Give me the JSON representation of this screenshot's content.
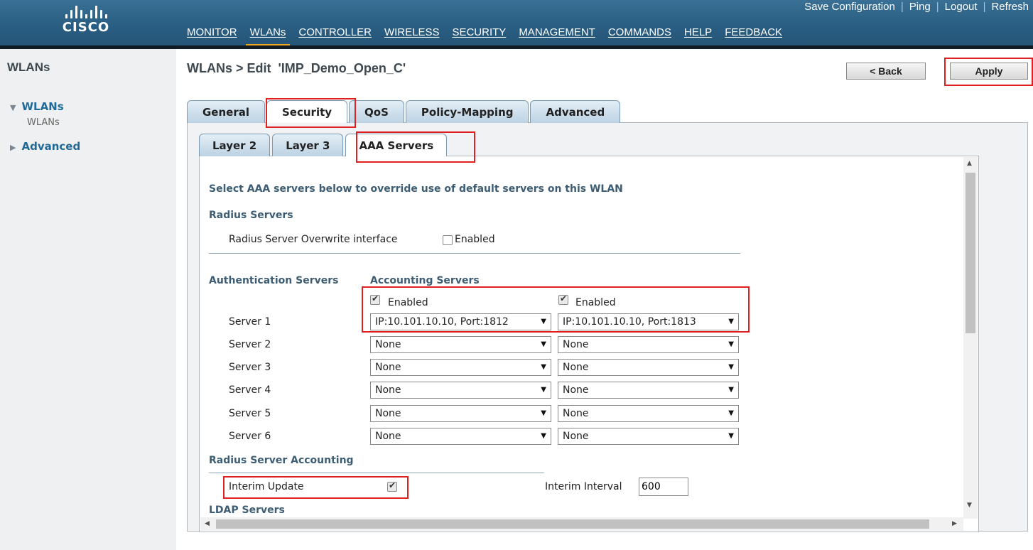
{
  "header": {
    "logo_text": "CISCO",
    "top_links": [
      "Save Configuration",
      "Ping",
      "Logout",
      "Refresh"
    ],
    "nav": [
      {
        "label": "MONITOR",
        "active": false
      },
      {
        "label": "WLANs",
        "active": true
      },
      {
        "label": "CONTROLLER",
        "active": false
      },
      {
        "label": "WIRELESS",
        "active": false
      },
      {
        "label": "SECURITY",
        "active": false
      },
      {
        "label": "MANAGEMENT",
        "active": false
      },
      {
        "label": "COMMANDS",
        "active": false
      },
      {
        "label": "HELP",
        "active": false
      },
      {
        "label": "FEEDBACK",
        "active": false
      }
    ],
    "accent_color": "#f5a623"
  },
  "sidebar": {
    "title": "WLANs",
    "items": [
      {
        "label": "WLANs",
        "expanded": true,
        "sub": "WLANs"
      },
      {
        "label": "Advanced",
        "expanded": false
      }
    ]
  },
  "page": {
    "title": "WLANs > Edit  'IMP_Demo_Open_C'",
    "back_label": "< Back",
    "apply_label": "Apply"
  },
  "tabs": [
    "General",
    "Security",
    "QoS",
    "Policy-Mapping",
    "Advanced"
  ],
  "subtabs": [
    "Layer 2",
    "Layer 3",
    "AAA Servers"
  ],
  "aaa": {
    "intro": "Select AAA servers below to override use of default servers on this WLAN",
    "radius_header": "Radius Servers",
    "overwrite_label": "Radius Server Overwrite interface",
    "overwrite_enabled_label": "Enabled",
    "auth_header": "Authentication Servers",
    "acct_header": "Accounting Servers",
    "auth_enabled_label": "Enabled",
    "acct_enabled_label": "Enabled",
    "servers": [
      {
        "label": "Server 1",
        "auth": "IP:10.101.10.10, Port:1812",
        "acct": "IP:10.101.10.10, Port:1813"
      },
      {
        "label": "Server 2",
        "auth": "None",
        "acct": "None"
      },
      {
        "label": "Server 3",
        "auth": "None",
        "acct": "None"
      },
      {
        "label": "Server 4",
        "auth": "None",
        "acct": "None"
      },
      {
        "label": "Server 5",
        "auth": "None",
        "acct": "None"
      },
      {
        "label": "Server 6",
        "auth": "None",
        "acct": "None"
      }
    ],
    "accounting_header": "Radius Server Accounting",
    "interim_update_label": "Interim Update",
    "interim_interval_label": "Interim Interval",
    "interim_interval_value": "600",
    "ldap_header": "LDAP Servers"
  },
  "highlight_color": "#e02020"
}
